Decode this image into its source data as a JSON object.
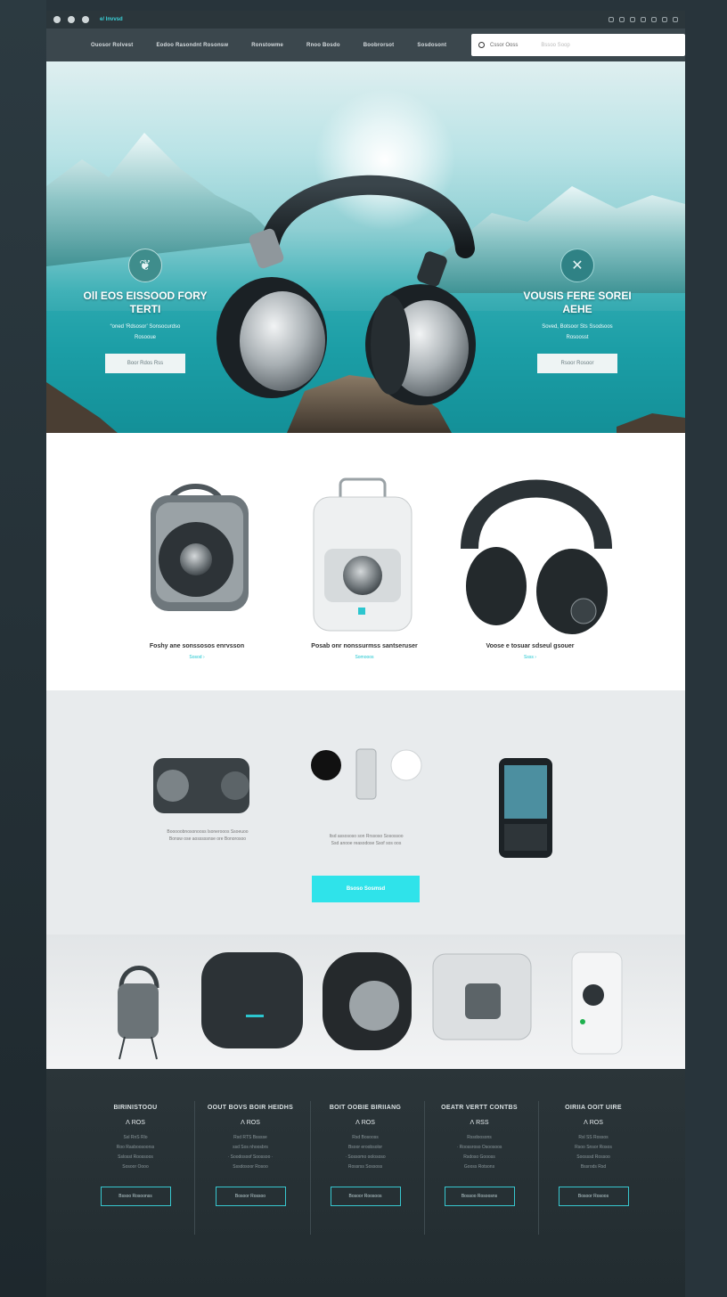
{
  "topbar": {
    "brand": "e/ Invvsd",
    "icons": [
      "circle-icon",
      "circle-icon",
      "speaker-icon"
    ],
    "right_icons": [
      "user-icon",
      "heart-icon",
      "cart-icon",
      "bell-icon",
      "settings-icon",
      "globe-icon",
      "menu-icon"
    ]
  },
  "nav": {
    "items": [
      "Ouosor Rolvest",
      "Eodoo Rasondnt Rosonsw",
      "Ronstowme",
      "Rnoo Bosdo",
      "Boobrorsot",
      "Sosdosont"
    ],
    "search_label": "Cssor Ooss",
    "search_placeholder": "Bssoo Soop"
  },
  "hero": {
    "left": {
      "title": "Oll EOS EISSOOD FORY TERTI",
      "sub1": "“oned ‘Rdsosor’ Sonsocurdso",
      "sub2": "Rosooue",
      "button": "Boor Rdos Rss"
    },
    "right": {
      "title": "VOUSIS FERE SOREI AEHE",
      "sub1": "Soved, Botsoor Sts Ssodsoos",
      "sub2": "Rosoosst",
      "button": "Rsoor Rosoor"
    }
  },
  "products": [
    {
      "name": "Foshy ane sonssosos enrvsson",
      "link": "Sosod ›"
    },
    {
      "name": "Posab onr nonssurmss santseruser",
      "link": "Somooos"
    },
    {
      "name": "Voose e tosuar sdseul gsouer",
      "link": "Ssss ›"
    }
  ],
  "feature": {
    "left_text_1": "Booooobnosonooss lsonerooos Ssoeuoo",
    "left_text_2": "Bonsw ose aosssssnse ore Bonorosoo",
    "mid_text_1": "Itsd assososo son Rrssoso Sosossoo",
    "mid_text_2": "Ssd anooe reasodose Ssof sos oos",
    "cta": "Bsoso Sosmsd"
  },
  "footer": {
    "cols": [
      {
        "title": "BIRINISTOOU",
        "price": "Ʌ ROS",
        "lines": [
          "Ssl RnS Rlo",
          "Roo Rasboosoorss",
          "Sslosst Roossoos",
          "Sosoor Oooo"
        ],
        "button": "Bssoo Rosoonss"
      },
      {
        "title": "OOUT BOVS BOIR HEIDHS",
        "price": "Ʌ ROS",
        "lines": [
          "Rsd RTS Bsssse",
          "ssd Sos nhoosbrs",
          "· Soodosoof Soossoo ·",
          "Sssdosoor Rosoo"
        ],
        "button": "Bosoor Rossoo"
      },
      {
        "title": "BOIT OOBIE BIRIIANG",
        "price": "Ʌ ROS",
        "lines": [
          "Rsd Bosooss",
          "Bsoor eroobsolor",
          "· Sossomo oolososo",
          "Rossrss Sossoss"
        ],
        "button": "Bosoor Roosoos"
      },
      {
        "title": "OEATR VERTT CONTBS",
        "price": "Ʌ RSS",
        "lines": [
          "Rssdoosons",
          "· Roossroso Osoosoos",
          "Rsdoso Goooss",
          "Gooss Rotsons"
        ],
        "button": "Bossoo Rosoosns"
      },
      {
        "title": "OIRIIA OOIT UIRE",
        "price": "Ʌ ROS",
        "lines": [
          "Rsl SS Rossos",
          "Rsoo Snsor Rosos",
          "Soosssd Rossoo",
          "Bssrods Rsd"
        ],
        "button": "Bosoor Rosoos"
      }
    ]
  },
  "colors": {
    "accent": "#2fe3ea",
    "dark": "#2b363b",
    "footer": "#222c30"
  }
}
